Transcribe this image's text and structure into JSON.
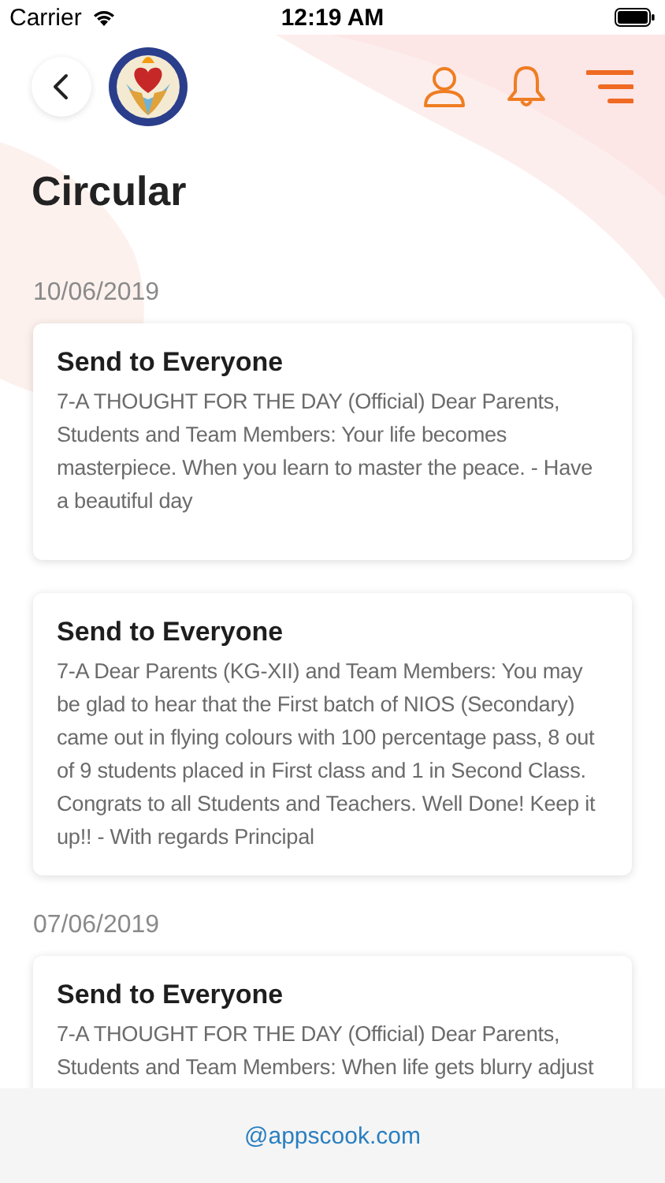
{
  "status_bar": {
    "carrier": "Carrier",
    "time": "12:19 AM"
  },
  "header": {
    "title": "Circular"
  },
  "groups": [
    {
      "date": "10/06/2019",
      "circulars": [
        {
          "title": "Send to Everyone",
          "body": "7-A THOUGHT FOR THE DAY (Official) Dear Parents, Students and Team Members: Your life becomes masterpiece. When you learn to master the peace. - Have a beautiful day"
        },
        {
          "title": "Send to Everyone",
          "body": "7-A Dear Parents (KG-XII) and Team Members: You may be glad to hear that the First batch of NIOS (Secondary) came out in flying colours with 100 percentage pass, 8 out of 9 students placed in First class and 1 in Second Class. Congrats to all Students and Teachers. Well Done! Keep it up!! - With regards Principal"
        }
      ]
    },
    {
      "date": "07/06/2019",
      "circulars": [
        {
          "title": "Send to Everyone",
          "body": "7-A THOUGHT FOR THE DAY (Official) Dear Parents, Students and Team Members: When life gets blurry adjust"
        }
      ]
    }
  ],
  "footer": {
    "link": "@appscook.com"
  }
}
